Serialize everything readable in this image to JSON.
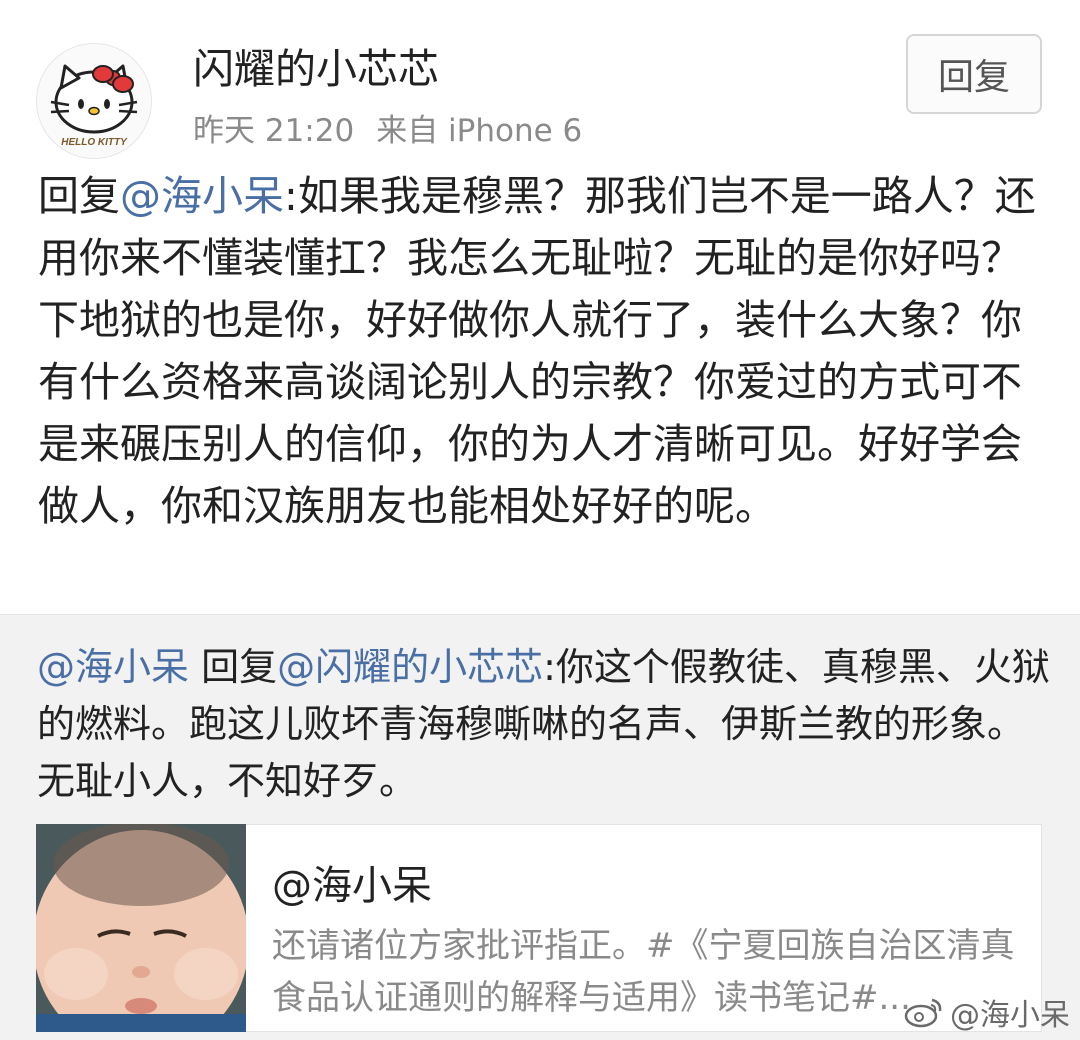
{
  "post": {
    "username": "闪耀的小芯芯",
    "time": "昨天 21:20",
    "source": "来自 iPhone 6",
    "reply_button": "回复",
    "body": {
      "prefix": "回复",
      "mention": "@海小呆",
      "text": ":如果我是穆黑？那我们岂不是一路人？还用你来不懂装懂扛？我怎么无耻啦？无耻的是你好吗？下地狱的也是你，好好做你人就行了，装什么大象？你有什么资格来高谈阔论别人的宗教？你爱过的方式可不是来碾压别人的信仰，你的为人才清晰可见。好好学会做人，你和汉族朋友也能相处好好的呢。"
    },
    "avatar_text": "HELLO KITTY"
  },
  "quoted": {
    "author_mention": "@海小呆",
    "reply_word": " 回复",
    "target_mention": "@闪耀的小芯芯",
    "text": ":你这个假教徒、真穆黑、火狱的燃料。跑这儿败坏青海穆嘶啉的名声、伊斯兰教的形象。无耻小人，不知好歹。",
    "card": {
      "title": "@海小呆",
      "description": "还请诸位方家批评指正。#《宁夏回族自治区清真食品认证通则的解释与适用》读书笔记#..."
    }
  },
  "watermark": {
    "text": "@海小呆"
  },
  "colors": {
    "mention": "#4a6fa5",
    "meta": "#8a8a8a",
    "quoted_bg": "#f2f2f2"
  }
}
